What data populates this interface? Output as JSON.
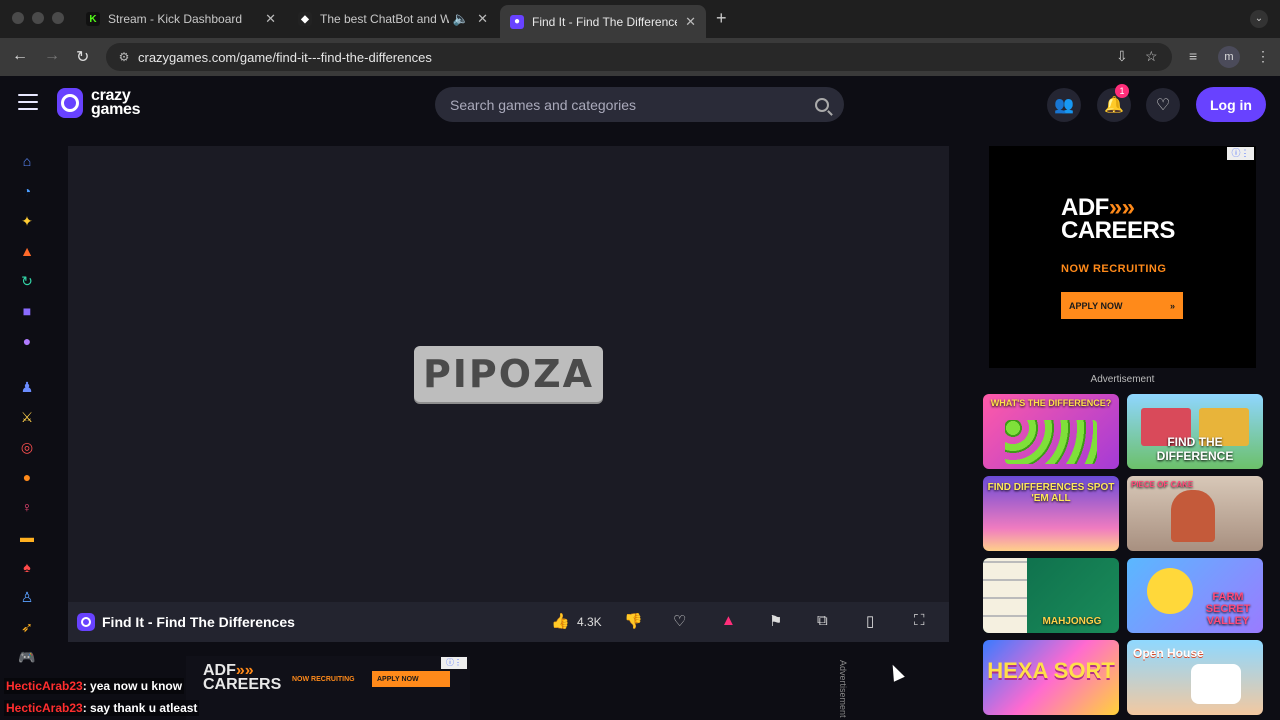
{
  "browser": {
    "tabs": [
      {
        "title": "Stream - Kick Dashboard",
        "favicon": "kick-icon",
        "active": false
      },
      {
        "title": "The best ChatBot and Wi",
        "favicon": "botrix-icon",
        "active": false
      },
      {
        "title": "Find It - Find The Differences",
        "favicon": "crazygames-icon",
        "active": true
      }
    ],
    "url": "crazygames.com/game/find-it---find-the-differences",
    "profile_initial": "m"
  },
  "header": {
    "logo_line1": "crazy",
    "logo_line2": "games",
    "search_placeholder": "Search games and categories",
    "notification_count": "1",
    "login_label": "Log in"
  },
  "sidebar": {
    "icons": [
      "home-icon",
      "recent-icon",
      "new-icon",
      "trending-icon",
      "updated-icon",
      "originals-icon",
      "multiplayer-icon",
      "two-player-icon",
      "action-icon",
      "adventure-icon",
      "basketball-icon",
      "beauty-icon",
      "car-icon",
      "card-icon",
      "casual-icon",
      "clicker-icon",
      "controller-icon"
    ]
  },
  "game": {
    "splash_text": "PIPOZA",
    "title": "Find It - Find The Differences",
    "likes": "4.3K"
  },
  "ads": {
    "right": {
      "brand": "ADF",
      "brand2": "CAREERS",
      "recruiting": "NOW RECRUITING",
      "apply": "APPLY NOW",
      "label": "Advertisement"
    },
    "bottom": {
      "brand": "ADF",
      "brand2": "CAREERS",
      "recruiting": "NOW RECRUITING",
      "apply": "APPLY NOW",
      "side_label": "Advertisement"
    }
  },
  "related_games": [
    {
      "caption": "WHAT'S THE DIFFERENCE?"
    },
    {
      "caption": "FIND THE DIFFERENCE"
    },
    {
      "caption": "FIND DIFFERENCES SPOT 'EM ALL"
    },
    {
      "caption": "PIECE OF CAKE"
    },
    {
      "caption": "MAHJONGG"
    },
    {
      "caption": "FARM SECRET VALLEY"
    },
    {
      "caption": "HEXA SORT"
    },
    {
      "caption": "Open House"
    }
  ],
  "chat": [
    {
      "user": "HecticArab23",
      "message": ": yea now u know"
    },
    {
      "user": "HecticArab23",
      "message": ": say thank u atleast"
    }
  ]
}
